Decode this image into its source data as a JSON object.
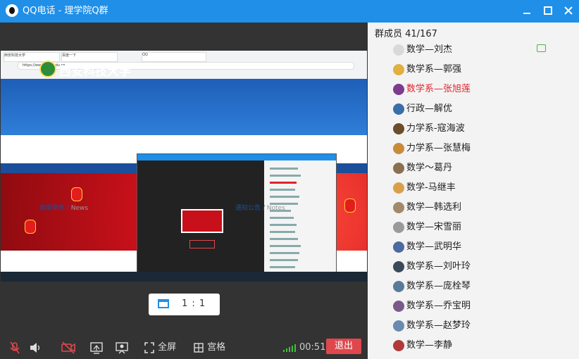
{
  "window": {
    "title": "QQ电话 - 理学院Q群"
  },
  "shared_screen": {
    "url": "https://www.xust.edu.cn",
    "tabs": [
      "西安科技大学",
      "百度一下",
      "QQ"
    ],
    "site_name": "西安科技大学",
    "news_label": "新闻聚焦",
    "news_en": "News",
    "notice_label": "通知公告",
    "notice_en": "Notes"
  },
  "view": {
    "ratio_label": "1 : 1"
  },
  "toolbar": {
    "fullscreen_label": "全屏",
    "grid_label": "宫格",
    "timer": "00:51",
    "exit_label": "退出"
  },
  "members": {
    "count_label": "群成员 41/167",
    "items": [
      {
        "name": "数学—刘杰",
        "color": "#d9d9d9",
        "highlight": false
      },
      {
        "name": "数学系—郭强",
        "color": "#e0b040",
        "highlight": false
      },
      {
        "name": "数学系—张旭莲",
        "color": "#7d3b8f",
        "highlight": true
      },
      {
        "name": "行政—解优",
        "color": "#3a6ea8",
        "highlight": false
      },
      {
        "name": "力学系-寇海波",
        "color": "#6b4d2b",
        "highlight": false
      },
      {
        "name": "力学系—张慧梅",
        "color": "#c88b3a",
        "highlight": false
      },
      {
        "name": "数学～葛丹",
        "color": "#8a7050",
        "highlight": false
      },
      {
        "name": "数学-马继丰",
        "color": "#d9a04a",
        "highlight": false
      },
      {
        "name": "数学—韩选利",
        "color": "#a08a6a",
        "highlight": false
      },
      {
        "name": "数学—宋雪丽",
        "color": "#9a9a9a",
        "highlight": false
      },
      {
        "name": "数学—武明华",
        "color": "#4a6aa0",
        "highlight": false
      },
      {
        "name": "数学系—刘叶玲",
        "color": "#3a4a5a",
        "highlight": false
      },
      {
        "name": "数学系—庞栓琴",
        "color": "#5a7a9a",
        "highlight": false
      },
      {
        "name": "数学系—乔宝明",
        "color": "#7a5a8a",
        "highlight": false
      },
      {
        "name": "数学系—赵梦玲",
        "color": "#6a8ab0",
        "highlight": false
      },
      {
        "name": "数学—李静",
        "color": "#b03a3a",
        "highlight": false
      }
    ]
  },
  "colors": {
    "accent": "#1f8fe8",
    "exit": "#e0474c",
    "signal": "#3ec23e",
    "highlight": "#e0242c"
  }
}
